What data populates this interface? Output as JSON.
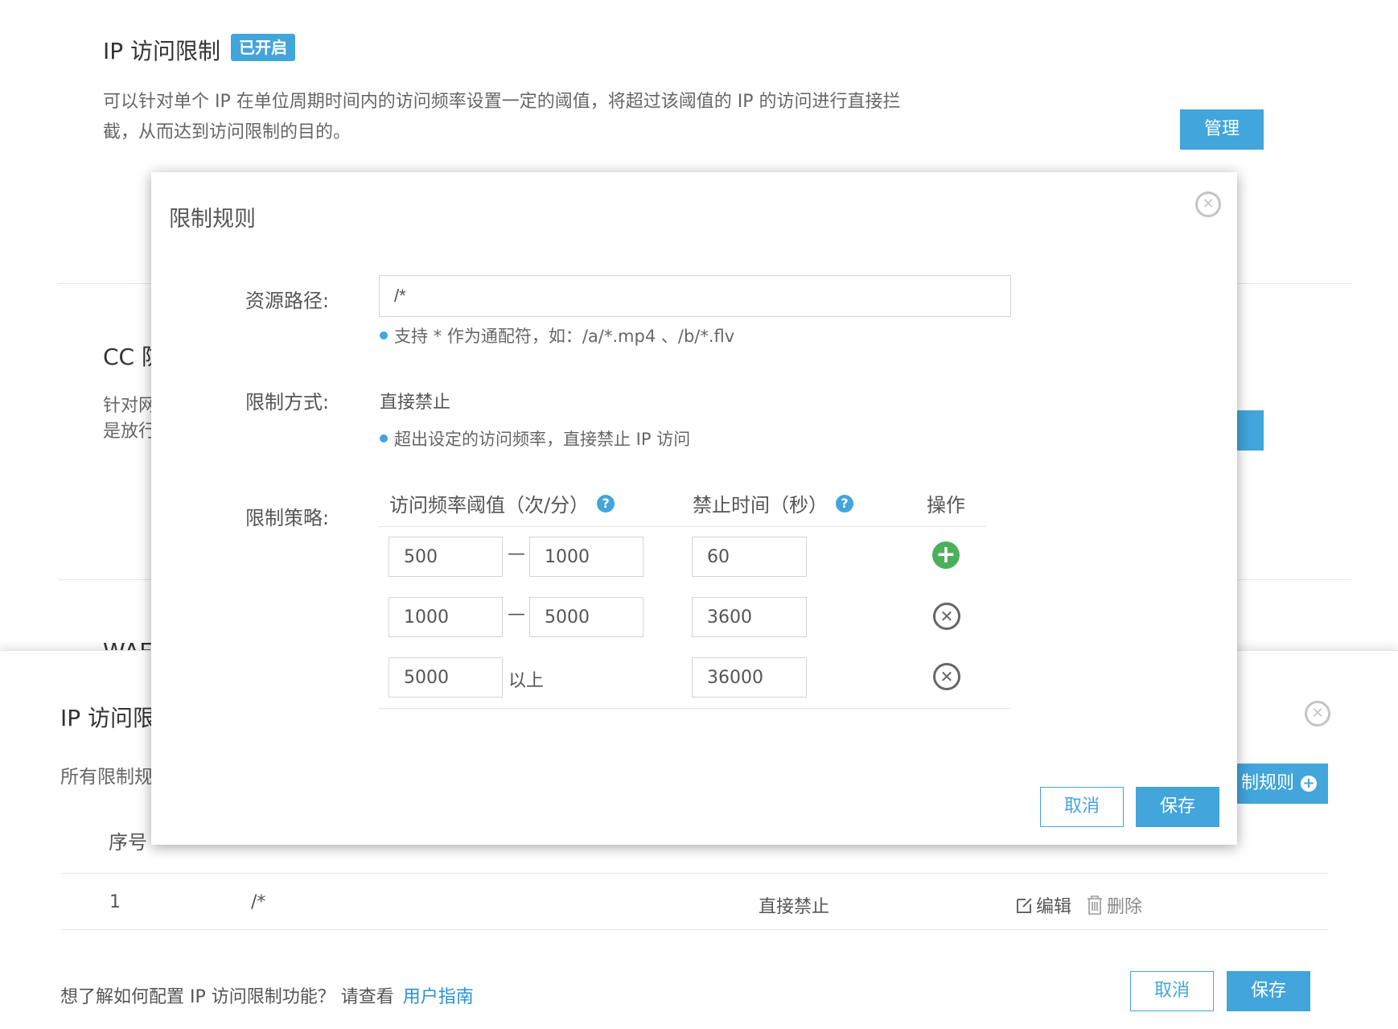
{
  "ip_section": {
    "title": "IP 访问限制",
    "badge": "已开启",
    "desc_line1": "可以针对单个 IP 在单位周期时间内的访问频率设置一定的阈值，将超过该阈值的 IP 的访问进行直接拦",
    "desc_line2": "截，从而达到访问限制的目的。",
    "manage_button": "管理"
  },
  "cc_section": {
    "title_partial": "CC 防",
    "desc_line1_partial": "针对网",
    "desc_line2_partial": "是放行"
  },
  "waf_section": {
    "title_partial": "WAF"
  },
  "rules_panel": {
    "title_partial": "IP 访问限",
    "all_rules_partial": "所有限制规",
    "add_rule_button_partial": "制规则",
    "table": {
      "header_seq": "序号",
      "rows": [
        {
          "seq": "1",
          "path": "/*",
          "mode": "直接禁止",
          "edit": "编辑",
          "delete": "删除"
        }
      ]
    },
    "footer_text": "想了解如何配置 IP 访问限制功能？ 请查看",
    "footer_link": "用户指南",
    "cancel_button": "取消",
    "save_button": "保存"
  },
  "modal": {
    "title": "限制规则",
    "path_label": "资源路径:",
    "path_value": "/*",
    "path_hint": "支持 * 作为通配符，如：/a/*.mp4 、/b/*.flv",
    "mode_label": "限制方式:",
    "mode_value": "直接禁止",
    "mode_hint": "超出设定的访问频率，直接禁止 IP 访问",
    "strategy_label": "限制策略:",
    "col_threshold": "访问频率阈值（次/分）",
    "col_ban_time": "禁止时间（秒）",
    "col_action": "操作",
    "rows": [
      {
        "from": "500",
        "to": "1000",
        "ban": "60",
        "action": "add"
      },
      {
        "from": "1000",
        "to": "5000",
        "ban": "3600",
        "action": "remove"
      },
      {
        "from": "5000",
        "above": "以上",
        "ban": "36000",
        "action": "remove"
      }
    ],
    "cancel_button": "取消",
    "save_button": "保存"
  },
  "colors": {
    "accent": "#42a5db",
    "add_green": "#4cb05a"
  }
}
